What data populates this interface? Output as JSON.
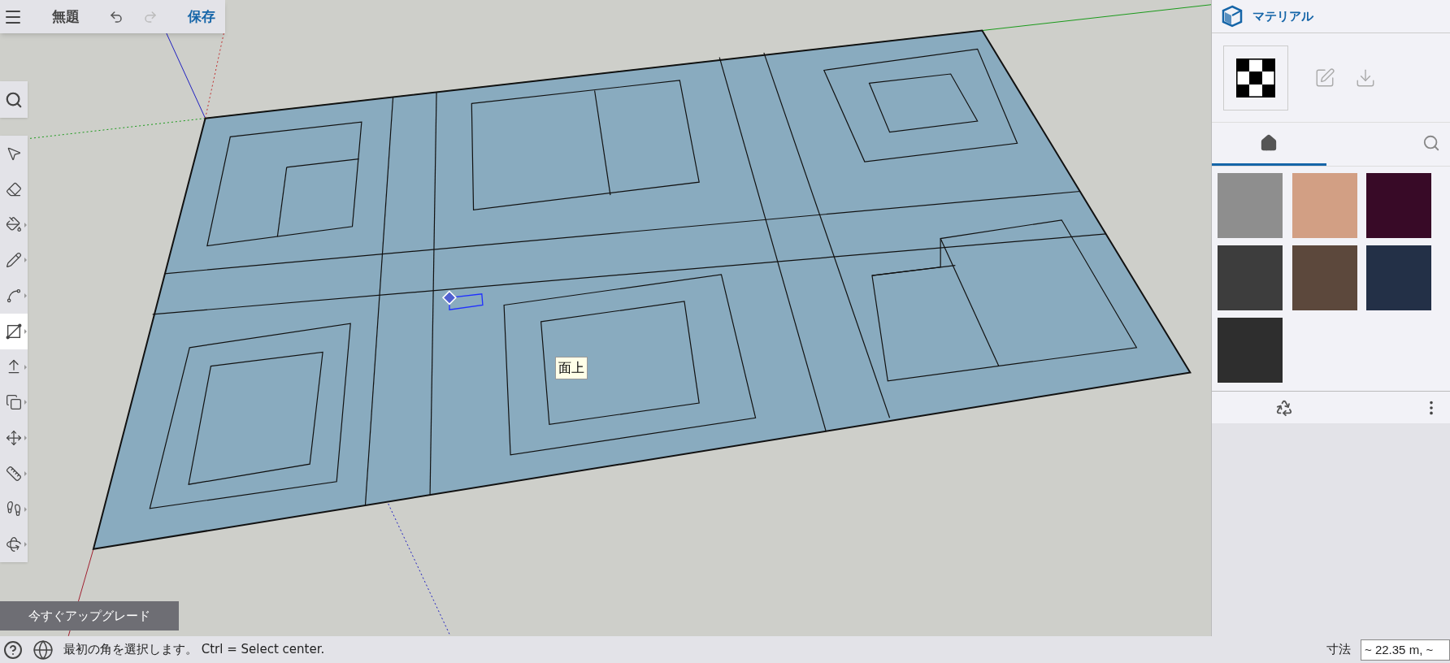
{
  "toolbar": {
    "title": "無題",
    "save_label": "保存",
    "undo": {
      "disabled": false
    },
    "redo": {
      "disabled": true
    }
  },
  "tools": [
    {
      "kind": "select",
      "selected": false,
      "flyout": false
    },
    {
      "kind": "eraser",
      "selected": false,
      "flyout": false
    },
    {
      "kind": "paint",
      "selected": false,
      "flyout": true
    },
    {
      "kind": "pencil",
      "selected": false,
      "flyout": true
    },
    {
      "kind": "arc",
      "selected": false,
      "flyout": true
    },
    {
      "kind": "rectangle",
      "selected": true,
      "flyout": true
    },
    {
      "kind": "pushpull",
      "selected": false,
      "flyout": true
    },
    {
      "kind": "offset",
      "selected": false,
      "flyout": true
    },
    {
      "kind": "move",
      "selected": false,
      "flyout": true
    },
    {
      "kind": "tape",
      "selected": false,
      "flyout": true
    },
    {
      "kind": "walk",
      "selected": false,
      "flyout": true
    },
    {
      "kind": "orbit",
      "selected": false,
      "flyout": true
    }
  ],
  "viewport": {
    "tooltip": "面上"
  },
  "upgrade_button": "今すぐアップグレード",
  "materials_panel": {
    "title": "マテリアル",
    "tabs": [
      {
        "kind": "home",
        "selected": true
      },
      {
        "kind": "search",
        "selected": false
      }
    ],
    "swatches": [
      {
        "color": "#8e8e8e"
      },
      {
        "color": "#d29f84"
      },
      {
        "color": "#380a27"
      },
      {
        "color": "#3d3d3d"
      },
      {
        "color": "#5c483c"
      },
      {
        "color": "#233047"
      },
      {
        "color": "#2e2e2e"
      }
    ]
  },
  "status_bar": {
    "message": "最初の角を選択します。 Ctrl = Select center.",
    "measure_label": "寸法",
    "measure_value": "~ 22.35 m, ~"
  }
}
